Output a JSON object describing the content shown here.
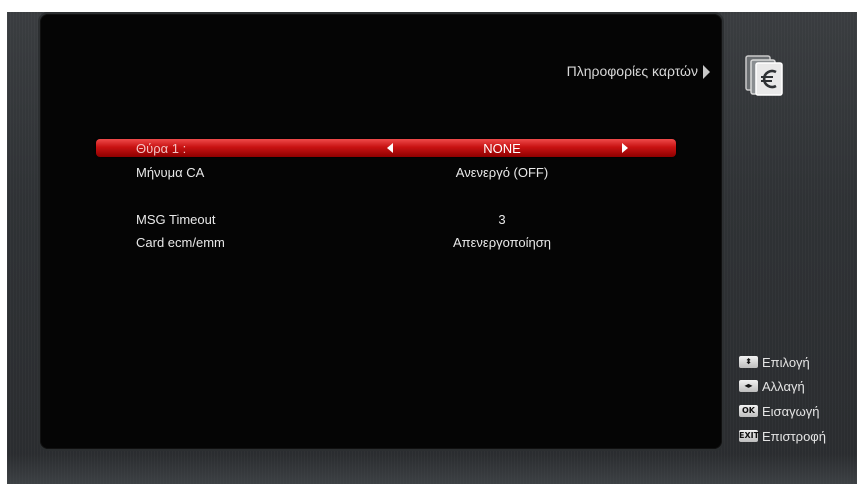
{
  "header": {
    "title": "Πληροφορίες καρτών"
  },
  "menu": {
    "rows": [
      {
        "label": "Θύρα 1 :",
        "value": "NONE",
        "selected": true
      },
      {
        "label": "Μήνυμα CA",
        "value": "Ανενεργό (OFF)"
      },
      {
        "label": "MSG Timeout",
        "value": "3"
      },
      {
        "label": "Card ecm/emm",
        "value": "Απενεργοποίηση"
      }
    ]
  },
  "help": {
    "items": [
      {
        "key": "⬍",
        "label": "Επιλογή"
      },
      {
        "key": "◂▸",
        "label": "Αλλαγή"
      },
      {
        "key": "OK",
        "label": "Εισαγωγή"
      },
      {
        "key": "EXIT",
        "label": "Επιστροφή"
      }
    ]
  },
  "colors": {
    "highlight": "#d01818",
    "panel": "#050505",
    "background": "#303335",
    "text": "#e9e9e9"
  }
}
